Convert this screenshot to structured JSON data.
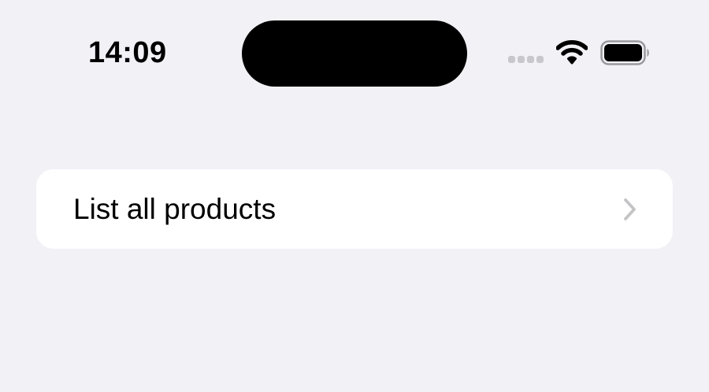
{
  "status_bar": {
    "time": "14:09",
    "icons": [
      "cellular-signal-icon",
      "wifi-icon",
      "battery-icon"
    ]
  },
  "list": {
    "items": [
      {
        "label": "List all products",
        "icon": "chevron-right-icon"
      }
    ]
  },
  "colors": {
    "background": "#f2f1f6",
    "card": "#ffffff",
    "chevron": "#c4c4c7",
    "signal_inactive": "#c7c7cc",
    "text": "#000000"
  }
}
